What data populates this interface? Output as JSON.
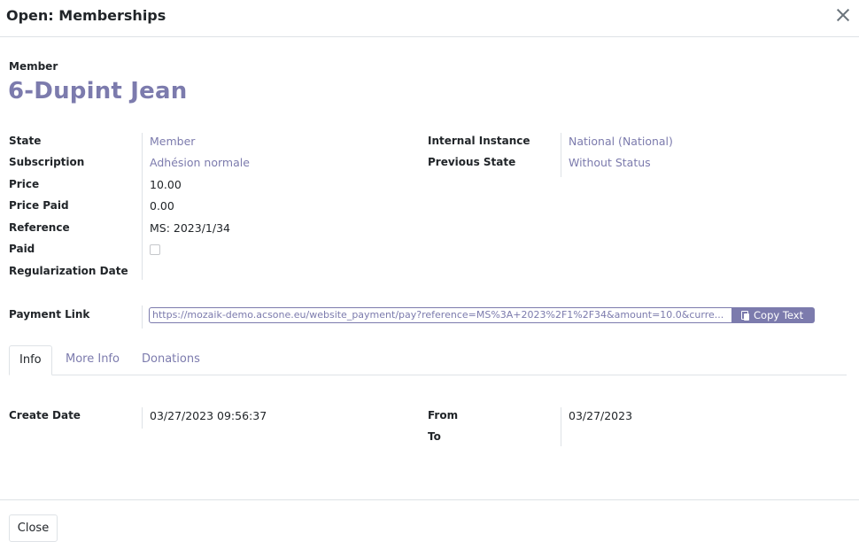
{
  "dialog": {
    "title": "Open: Memberships",
    "close_icon": "close-icon"
  },
  "member": {
    "label": "Member",
    "name": "6-Dupint Jean"
  },
  "fields_left": {
    "state_label": "State",
    "state_value": "Member",
    "subscription_label": "Subscription",
    "subscription_value": "Adhésion normale",
    "price_label": "Price",
    "price_value": "10.00",
    "price_paid_label": "Price Paid",
    "price_paid_value": "0.00",
    "reference_label": "Reference",
    "reference_value": "MS: 2023/1/34",
    "paid_label": "Paid",
    "paid_value": false,
    "regularization_label": "Regularization Date",
    "regularization_value": ""
  },
  "fields_right": {
    "internal_instance_label": "Internal Instance",
    "internal_instance_value": "National (National)",
    "previous_state_label": "Previous State",
    "previous_state_value": "Without Status"
  },
  "payment_link": {
    "label": "Payment Link",
    "value": "https://mozaik-demo.acsone.eu/website_payment/pay?reference=MS%3A+2023%2F1%2F34&amount=10.0&curre...",
    "copy_label": "Copy Text",
    "copy_icon": "clipboard-icon"
  },
  "tabs": [
    {
      "label": "Info",
      "active": true
    },
    {
      "label": "More Info",
      "active": false
    },
    {
      "label": "Donations",
      "active": false
    }
  ],
  "info_tab": {
    "create_date_label": "Create Date",
    "create_date_value": "03/27/2023 09:56:37",
    "from_label": "From",
    "from_value": "03/27/2023",
    "to_label": "To",
    "to_value": ""
  },
  "footer": {
    "close_label": "Close"
  },
  "colors": {
    "accent": "#7c7bad",
    "border": "#dee2e6",
    "text": "#212529"
  }
}
